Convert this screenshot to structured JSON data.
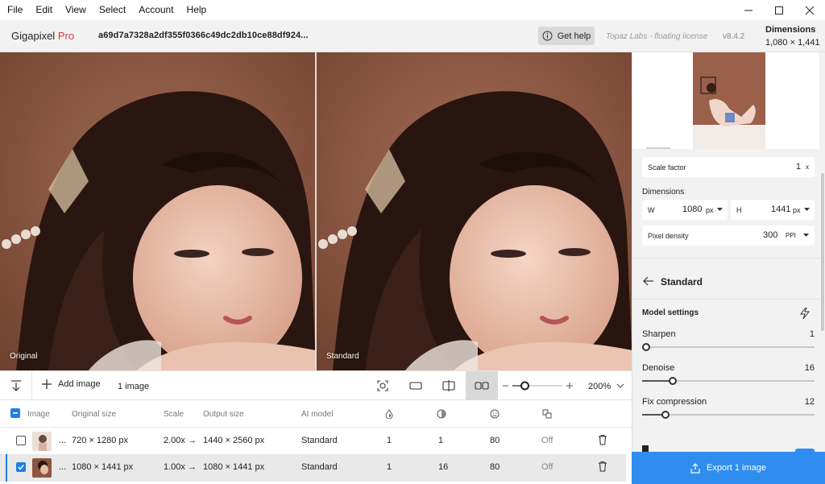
{
  "menu": [
    "File",
    "Edit",
    "View",
    "Select",
    "Account",
    "Help"
  ],
  "header": {
    "app_name": "Gigapixel",
    "app_tier": "Pro",
    "filename": "a69d7a7328a2df355f0366c49dc2db10ce88df924...",
    "help_label": "Get help",
    "license": "Topaz Labs - floating license",
    "version": "v8.4.2",
    "dimensions_label": "Dimensions",
    "dimensions_value": "1,080 × 1,441"
  },
  "preview": {
    "left_label": "Original",
    "right_label": "Standard"
  },
  "toolbar": {
    "add_image": "Add image",
    "image_count": "1 image",
    "zoom": "200%",
    "zoom_level": 0.25
  },
  "table": {
    "headers": {
      "image": "Image",
      "original_size": "Original size",
      "scale": "Scale",
      "output_size": "Output size",
      "ai_model": "AI model"
    },
    "rows": [
      {
        "ellipsis": "...",
        "original_size": "720 × 1280 px",
        "scale": "2.00x →",
        "output_size": "1440 × 2560 px",
        "model": "Standard",
        "sharpen": "1",
        "denoise": "1",
        "face": "80",
        "extra": "Off",
        "checked": false
      },
      {
        "ellipsis": "...",
        "original_size": "1080 × 1441 px",
        "scale": "1.00x →",
        "output_size": "1080 × 1441 px",
        "model": "Standard",
        "sharpen": "1",
        "denoise": "16",
        "face": "80",
        "extra": "Off",
        "checked": true
      }
    ]
  },
  "panel": {
    "scale_factor_label": "Scale factor",
    "scale_factor_value": "1",
    "scale_factor_unit": "x",
    "dimensions_label": "Dimensions",
    "w_label": "W",
    "w_value": "1080",
    "w_unit": "px",
    "h_label": "H",
    "h_value": "1441",
    "h_unit": "px",
    "density_label": "Pixel density",
    "density_value": "300",
    "density_unit": "PPI",
    "model_name": "Standard",
    "model_settings_label": "Model settings",
    "sliders": [
      {
        "label": "Sharpen",
        "value": "1",
        "level": 0.0
      },
      {
        "label": "Denoise",
        "value": "16",
        "level": 0.16
      },
      {
        "label": "Fix compression",
        "value": "12",
        "level": 0.12
      }
    ]
  },
  "export_label": "Export 1 image",
  "colors": {
    "accent": "#2f8df0",
    "brand_pro": "#e8334b",
    "selection": "#1f7ee6"
  }
}
